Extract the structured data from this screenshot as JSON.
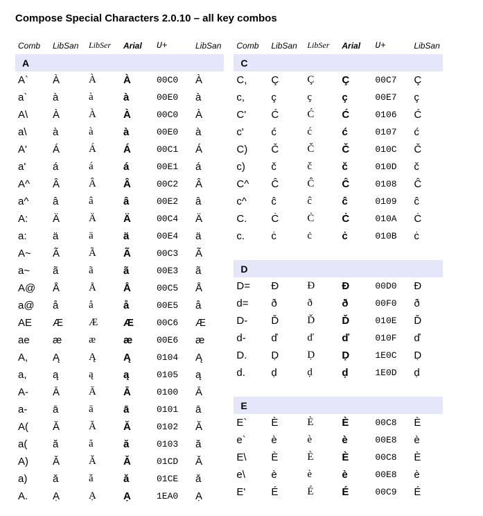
{
  "title": "Compose Special Characters 2.0.10 – all key combos",
  "headers": [
    "Comb",
    "LibSan",
    "LibSer",
    "Arial",
    "U+",
    "LibSan"
  ],
  "left": [
    {
      "section": "A"
    },
    {
      "comb": "A`",
      "ch": "À",
      "u": "00C0"
    },
    {
      "comb": "a`",
      "ch": "à",
      "u": "00E0"
    },
    {
      "comb": "A\\",
      "ch": "À",
      "u": "00C0"
    },
    {
      "comb": "a\\",
      "ch": "à",
      "u": "00E0"
    },
    {
      "comb": "A'",
      "ch": "Á",
      "u": "00C1"
    },
    {
      "comb": "a'",
      "ch": "á",
      "u": "00E1"
    },
    {
      "comb": "A^",
      "ch": "Â",
      "u": "00C2"
    },
    {
      "comb": "a^",
      "ch": "â",
      "u": "00E2"
    },
    {
      "comb": "A:",
      "ch": "Ä",
      "u": "00C4"
    },
    {
      "comb": "a:",
      "ch": "ä",
      "u": "00E4"
    },
    {
      "comb": "A~",
      "ch": "Ã",
      "u": "00C3"
    },
    {
      "comb": "a~",
      "ch": "ã",
      "u": "00E3"
    },
    {
      "comb": "A@",
      "ch": "Å",
      "u": "00C5"
    },
    {
      "comb": "a@",
      "ch": "å",
      "u": "00E5"
    },
    {
      "comb": "AE",
      "ch": "Æ",
      "u": "00C6"
    },
    {
      "comb": "ae",
      "ch": "æ",
      "u": "00E6"
    },
    {
      "comb": "A,",
      "ch": "Ą",
      "u": "0104"
    },
    {
      "comb": "a,",
      "ch": "ą",
      "u": "0105"
    },
    {
      "comb": "A-",
      "ch": "Ā",
      "u": "0100"
    },
    {
      "comb": "a-",
      "ch": "ā",
      "u": "0101"
    },
    {
      "comb": "A(",
      "ch": "Ă",
      "u": "0102"
    },
    {
      "comb": "a(",
      "ch": "ă",
      "u": "0103"
    },
    {
      "comb": "A)",
      "ch": "Ǎ",
      "u": "01CD"
    },
    {
      "comb": "a)",
      "ch": "ǎ",
      "u": "01CE"
    },
    {
      "comb": "A.",
      "ch": "Ạ",
      "u": "1EA0"
    }
  ],
  "right": [
    {
      "section": "C"
    },
    {
      "comb": "C,",
      "ch": "Ç",
      "u": "00C7"
    },
    {
      "comb": "c,",
      "ch": "ç",
      "u": "00E7"
    },
    {
      "comb": "C'",
      "ch": "Ć",
      "u": "0106"
    },
    {
      "comb": "c'",
      "ch": "ć",
      "u": "0107"
    },
    {
      "comb": "C)",
      "ch": "Č",
      "u": "010C"
    },
    {
      "comb": "c)",
      "ch": "č",
      "u": "010D"
    },
    {
      "comb": "C^",
      "ch": "Ĉ",
      "u": "0108"
    },
    {
      "comb": "c^",
      "ch": "ĉ",
      "u": "0109"
    },
    {
      "comb": "C.",
      "ch": "Ċ",
      "u": "010A"
    },
    {
      "comb": "c.",
      "ch": "ċ",
      "u": "010B"
    },
    {
      "gap": true
    },
    {
      "section": "D"
    },
    {
      "comb": "D=",
      "ch": "Đ",
      "u": "00D0"
    },
    {
      "comb": "d=",
      "ch": "ð",
      "u": "00F0"
    },
    {
      "comb": "D-",
      "ch": "Ď",
      "u": "010E"
    },
    {
      "comb": "d-",
      "ch": "ď",
      "u": "010F"
    },
    {
      "comb": "D.",
      "ch": "Ḍ",
      "u": "1E0C"
    },
    {
      "comb": "d.",
      "ch": "ḍ",
      "u": "1E0D"
    },
    {
      "gap": true
    },
    {
      "section": "E"
    },
    {
      "comb": "E`",
      "ch": "È",
      "u": "00C8"
    },
    {
      "comb": "e`",
      "ch": "è",
      "u": "00E8"
    },
    {
      "comb": "E\\",
      "ch": "È",
      "u": "00C8"
    },
    {
      "comb": "e\\",
      "ch": "è",
      "u": "00E8"
    },
    {
      "comb": "E'",
      "ch": "É",
      "u": "00C9"
    }
  ]
}
